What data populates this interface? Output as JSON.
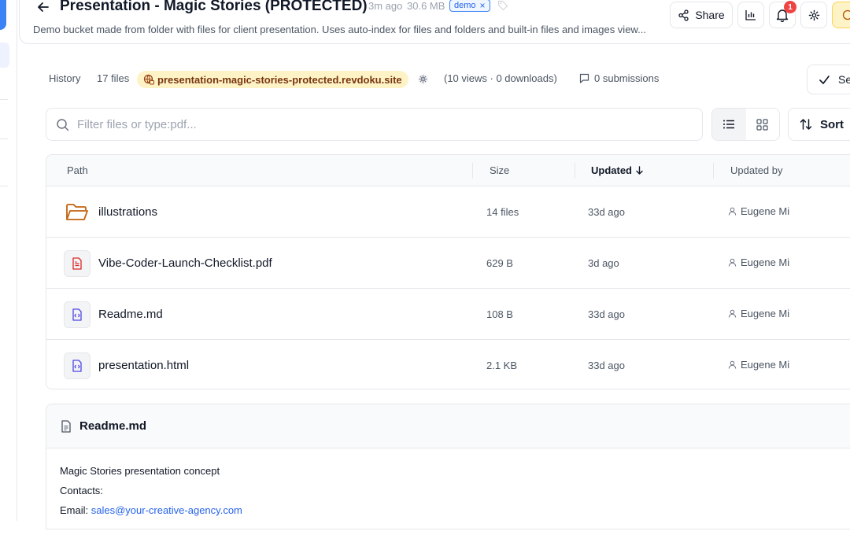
{
  "header": {
    "title": "Presentation - Magic Stories (PROTECTED)",
    "updated_ago": "3m ago",
    "size": "30.6 MB",
    "badge": "demo",
    "description": "Demo bucket made from folder with files for client presentation. Uses auto-index for files and folders and built-in files and images view...",
    "share_label": "Share",
    "notification_count": "1"
  },
  "info": {
    "history_label": "History",
    "files_count": "17 files",
    "site": "presentation-magic-stories-protected.revdoku.site",
    "views": "(10 views · 0 downloads)",
    "submissions": "0 submissions",
    "select_label": "Se"
  },
  "search": {
    "placeholder": "Filter files or type:pdf..."
  },
  "sort_label": "Sort",
  "table": {
    "headers": {
      "path": "Path",
      "size": "Size",
      "updated": "Updated",
      "updated_by": "Updated by"
    },
    "rows": [
      {
        "name": "illustrations",
        "size": "14 files",
        "updated": "33d ago",
        "by": "Eugene Mi",
        "type": "folder"
      },
      {
        "name": "Vibe-Coder-Launch-Checklist.pdf",
        "size": "629 B",
        "updated": "3d ago",
        "by": "Eugene Mi",
        "type": "pdf"
      },
      {
        "name": "Readme.md",
        "size": "108 B",
        "updated": "33d ago",
        "by": "Eugene Mi",
        "type": "code"
      },
      {
        "name": "presentation.html",
        "size": "2.1 KB",
        "updated": "33d ago",
        "by": "Eugene Mi",
        "type": "code"
      }
    ]
  },
  "readme": {
    "title": "Readme.md",
    "line1": "Magic Stories presentation concept",
    "line2": "Contacts:",
    "email_label": "Email: ",
    "email": "sales@your-creative-agency.com"
  },
  "colors": {
    "accent": "#2563eb",
    "folder": "#c2620e",
    "pdf": "#dc2626",
    "site_pill": "#fef3c7",
    "notification": "#ef4444"
  }
}
